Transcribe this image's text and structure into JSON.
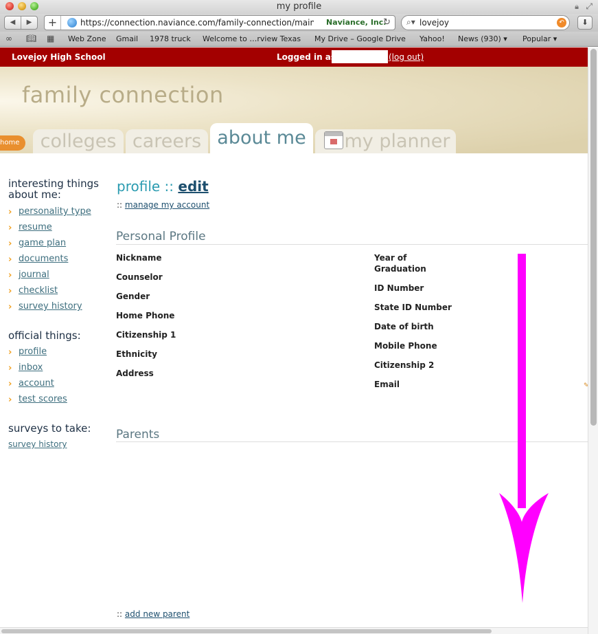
{
  "window": {
    "title": "my profile"
  },
  "toolbar": {
    "url": "https://connection.naviance.com/family-connection/main/p",
    "site_badge": "Naviance, Inc.",
    "search_value": "lovejoy"
  },
  "bookmarks": [
    "Web Zone",
    "Gmail",
    "1978 truck",
    "Welcome to …rview Texas",
    "My Drive – Google Drive",
    "Yahoo!",
    "News (930) ▾",
    "Popular ▾"
  ],
  "header": {
    "school": "Lovejoy High School",
    "logged_in_label": "Logged in as:",
    "logout": "(log out)"
  },
  "banner": {
    "title": "family connection"
  },
  "tabs": {
    "home": "home",
    "colleges": "colleges",
    "careers": "careers",
    "about_me": "about me",
    "my_planner": "my planner"
  },
  "sidebar": {
    "heading_interesting_1": "interesting things",
    "heading_interesting_2": "about me:",
    "interesting": [
      "personality type",
      "resume",
      "game plan",
      "documents",
      "journal",
      "checklist",
      "survey history"
    ],
    "heading_official": "official things:",
    "official": [
      "profile",
      "inbox",
      "account",
      "test scores"
    ],
    "heading_surveys": "surveys to take:",
    "survey_link": "survey history"
  },
  "main": {
    "title_prefix": "profile ::",
    "title_edit": "edit",
    "manage_prefix": "::",
    "manage_link": "manage my account",
    "personal_heading": "Personal Profile",
    "left_fields": [
      "Nickname",
      "Counselor",
      "Gender",
      "Home Phone",
      "Citizenship 1",
      "Ethnicity",
      "Address"
    ],
    "right_fields": [
      "Year of Graduation",
      "ID Number",
      "State ID Number",
      "Date of birth",
      "Mobile Phone",
      "Citizenship 2",
      "Email"
    ],
    "parents_heading": "Parents",
    "add_parent_prefix": "::",
    "add_parent_link": "add new parent"
  },
  "colors": {
    "header_red": "#a30000",
    "accent_teal": "#2a9bb0",
    "arrow_magenta": "#ff00ff",
    "home_orange": "#e98f2e"
  }
}
